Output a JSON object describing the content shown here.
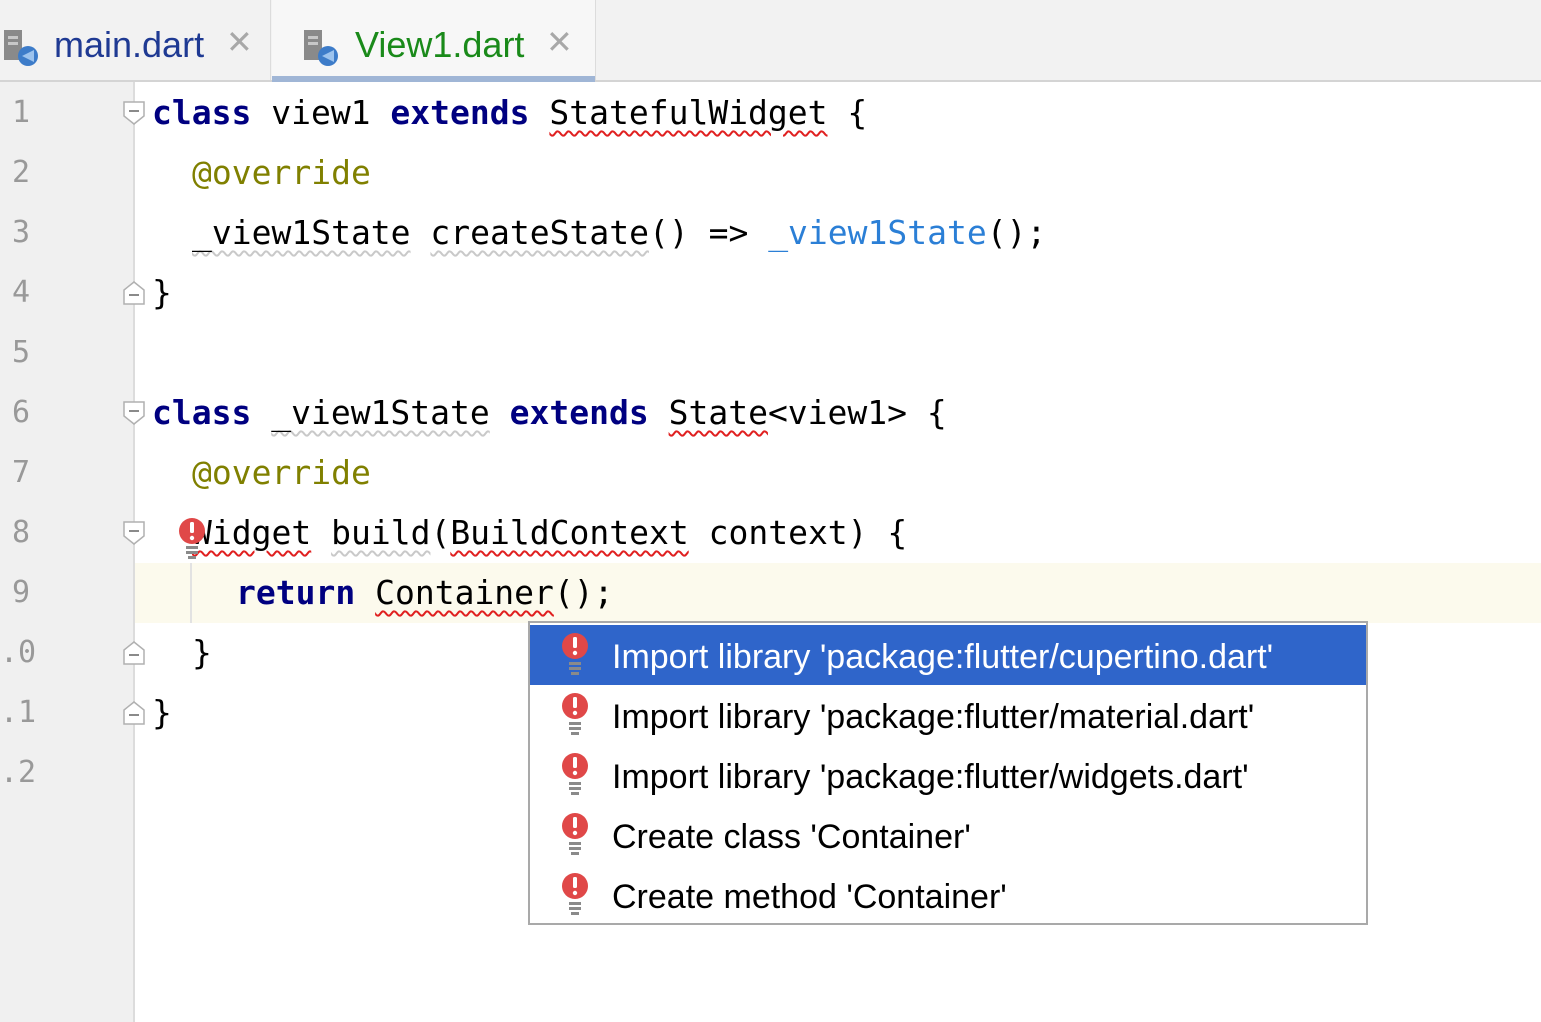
{
  "tabs": [
    {
      "label": "main.dart",
      "close": "✕",
      "icon": "dart-file-icon",
      "active": false
    },
    {
      "label": "View1.dart",
      "close": "✕",
      "icon": "dart-file-icon",
      "active": true
    }
  ],
  "editor": {
    "line_numbers": [
      "1",
      "2",
      "3",
      "4",
      "5",
      "6",
      "7",
      "8",
      "9",
      ".0",
      ".1",
      ".2"
    ],
    "current_line": 9,
    "code": {
      "l1": {
        "kw1": "class",
        "t1": " view1 ",
        "kw2": "extends",
        "t2": " ",
        "err": "StatefulWidget",
        "t3": " {"
      },
      "l2": {
        "ann": "@override"
      },
      "l3": {
        "t1": "_view1State",
        "t2": " ",
        "t3": "createState",
        "t4": "() => ",
        "ref": "_view1State",
        "t5": "();"
      },
      "l4": {
        "t1": "}"
      },
      "l6": {
        "kw1": "class",
        "t1": " ",
        "t2": "_view1State",
        "t3": " ",
        "kw2": "extends",
        "t4": " ",
        "err": "State",
        "t5": "<view1> {"
      },
      "l7": {
        "ann": "@override"
      },
      "l8": {
        "err1": "Widget",
        "t1": " ",
        "t2": "build",
        "t3": "(",
        "err2": "BuildContext",
        "t4": " context) {"
      },
      "l9": {
        "kw": "return",
        "t1": " ",
        "err": "Container",
        "t2": "();"
      },
      "l10": {
        "t1": "}"
      },
      "l11": {
        "t1": "}"
      }
    }
  },
  "quickfix_popup": {
    "items": [
      {
        "label": "Import library 'package:flutter/cupertino.dart'",
        "icon": "error-bulb-icon",
        "selected": true
      },
      {
        "label": "Import library 'package:flutter/material.dart'",
        "icon": "error-bulb-icon",
        "selected": false
      },
      {
        "label": "Import library 'package:flutter/widgets.dart'",
        "icon": "error-bulb-icon",
        "selected": false
      },
      {
        "label": "Create class 'Container'",
        "icon": "error-bulb-icon",
        "selected": false
      },
      {
        "label": "Create method 'Container'",
        "icon": "error-bulb-icon",
        "selected": false
      }
    ]
  },
  "colors": {
    "keyword": "#000080",
    "annotation": "#808000",
    "reference": "#2b7fd6",
    "error_underline": "#e02020",
    "selection": "#2f65ca",
    "current_line": "#fcfaed"
  }
}
